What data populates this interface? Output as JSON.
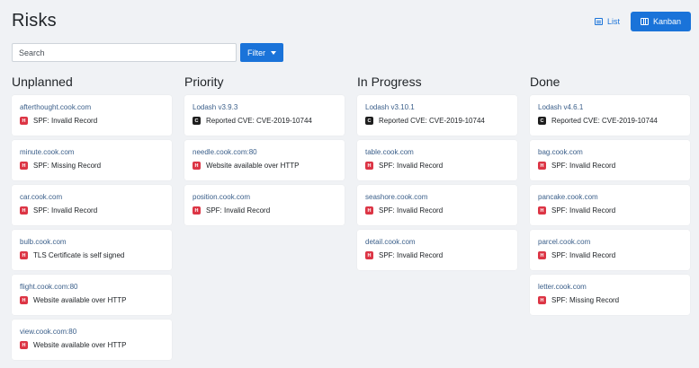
{
  "page": {
    "title": "Risks"
  },
  "view": {
    "list_label": "List",
    "kanban_label": "Kanban"
  },
  "search": {
    "placeholder": "Search"
  },
  "filter": {
    "label": "Filter"
  },
  "colors": {
    "accent": "#1a73d9",
    "high": "#dc3545",
    "critical": "#1e1e1e"
  },
  "columns": [
    {
      "title": "Unplanned",
      "cards": [
        {
          "host": "afterthought.cook.com",
          "severity": "H",
          "issue": "SPF: Invalid Record"
        },
        {
          "host": "minute.cook.com",
          "severity": "H",
          "issue": "SPF: Missing Record"
        },
        {
          "host": "car.cook.com",
          "severity": "H",
          "issue": "SPF: Invalid Record"
        },
        {
          "host": "bulb.cook.com",
          "severity": "H",
          "issue": "TLS Certificate is self signed"
        },
        {
          "host": "flight.cook.com:80",
          "severity": "H",
          "issue": "Website available over HTTP"
        },
        {
          "host": "view.cook.com:80",
          "severity": "H",
          "issue": "Website available over HTTP"
        }
      ]
    },
    {
      "title": "Priority",
      "cards": [
        {
          "host": "Lodash v3.9.3",
          "severity": "C",
          "issue": "Reported CVE: CVE-2019-10744"
        },
        {
          "host": "needle.cook.com:80",
          "severity": "H",
          "issue": "Website available over HTTP"
        },
        {
          "host": "position.cook.com",
          "severity": "H",
          "issue": "SPF: Invalid Record"
        }
      ]
    },
    {
      "title": "In Progress",
      "cards": [
        {
          "host": "Lodash v3.10.1",
          "severity": "C",
          "issue": "Reported CVE: CVE-2019-10744"
        },
        {
          "host": "table.cook.com",
          "severity": "H",
          "issue": "SPF: Invalid Record"
        },
        {
          "host": "seashore.cook.com",
          "severity": "H",
          "issue": "SPF: Invalid Record"
        },
        {
          "host": "detail.cook.com",
          "severity": "H",
          "issue": "SPF: Invalid Record"
        }
      ]
    },
    {
      "title": "Done",
      "cards": [
        {
          "host": "Lodash v4.6.1",
          "severity": "C",
          "issue": "Reported CVE: CVE-2019-10744"
        },
        {
          "host": "bag.cook.com",
          "severity": "H",
          "issue": "SPF: Invalid Record"
        },
        {
          "host": "pancake.cook.com",
          "severity": "H",
          "issue": "SPF: Invalid Record"
        },
        {
          "host": "parcel.cook.com",
          "severity": "H",
          "issue": "SPF: Invalid Record"
        },
        {
          "host": "letter.cook.com",
          "severity": "H",
          "issue": "SPF: Missing Record"
        }
      ]
    }
  ]
}
